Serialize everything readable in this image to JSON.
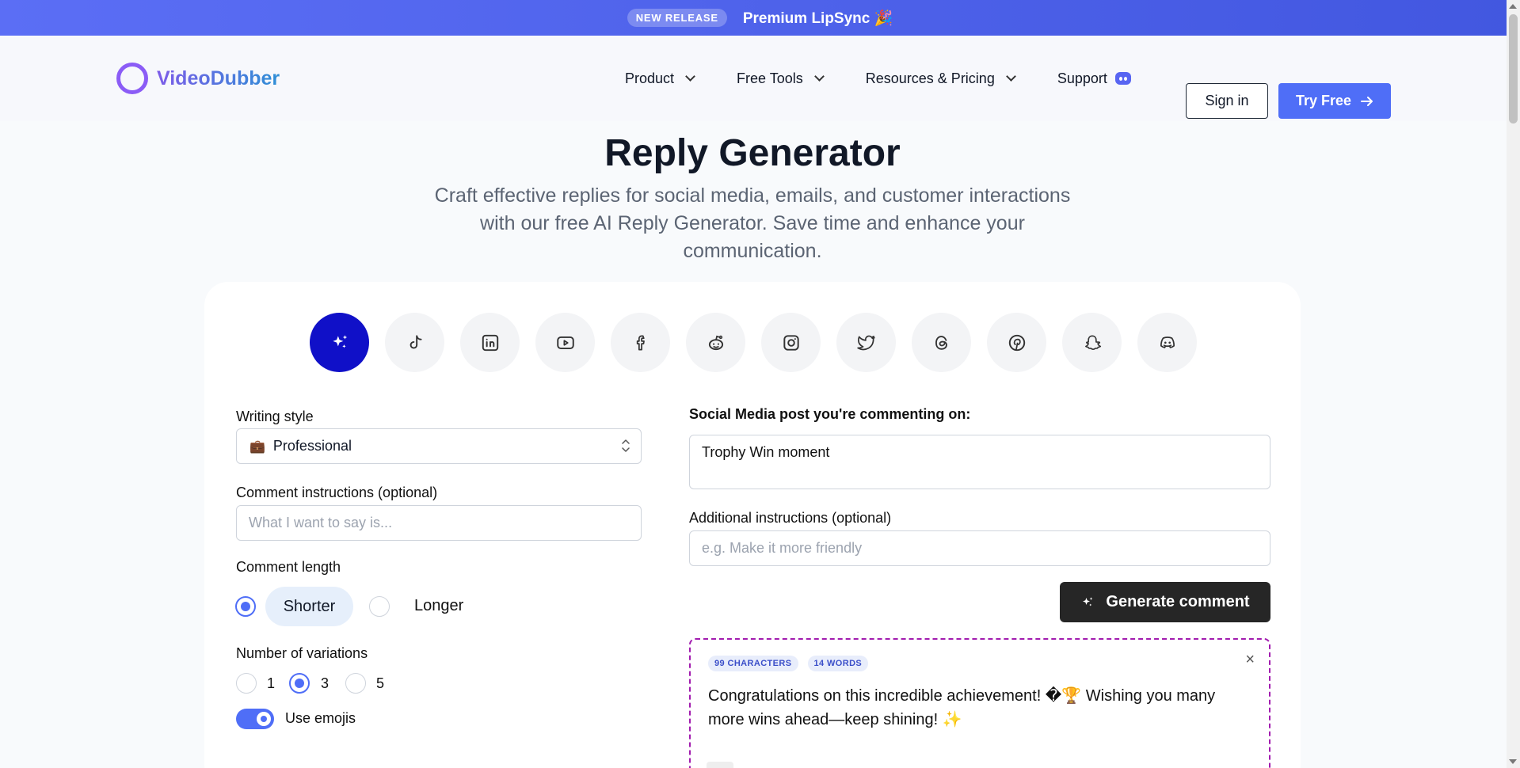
{
  "banner": {
    "badge": "NEW RELEASE",
    "text": "Premium LipSync 🎉"
  },
  "brand": {
    "name": "VideoDubber",
    "accent": "#4f6ef7"
  },
  "nav": {
    "items": [
      {
        "label": "Product"
      },
      {
        "label": "Free Tools"
      },
      {
        "label": "Resources & Pricing"
      },
      {
        "label": "Support"
      }
    ],
    "signin": "Sign in",
    "try_free": "Try Free"
  },
  "hero": {
    "title": "Reply Generator",
    "subtitle": "Craft effective replies for social media, emails, and customer interactions with our free AI Reply Generator. Save time and enhance your communication."
  },
  "platforms": [
    "sparkle-icon",
    "tiktok-icon",
    "linkedin-icon",
    "youtube-icon",
    "facebook-icon",
    "reddit-icon",
    "instagram-icon",
    "twitter-icon",
    "threads-icon",
    "pinterest-icon",
    "snapchat-icon",
    "discord-icon"
  ],
  "form": {
    "writing_style_label": "Writing style",
    "writing_style_icon": "💼",
    "writing_style_value": "Professional",
    "comment_instructions_label": "Comment instructions (optional)",
    "comment_instructions_placeholder": "What I want to say is...",
    "comment_length_label": "Comment length",
    "length_shorter": "Shorter",
    "length_longer": "Longer",
    "variations_label": "Number of variations",
    "variation_1": "1",
    "variation_3": "3",
    "variation_5": "5",
    "use_emojis": "Use emojis",
    "post_label": "Social Media post you're commenting on:",
    "post_value": "Trophy Win moment",
    "additional_label": "Additional instructions (optional)",
    "additional_placeholder": "e.g. Make it more friendly",
    "generate": "Generate comment"
  },
  "result": {
    "characters": "99 CHARACTERS",
    "words": "14 WORDS",
    "close": "×",
    "text": "Congratulations on this incredible achievement! �🏆 Wishing you many more wins ahead—keep shining! ✨"
  }
}
